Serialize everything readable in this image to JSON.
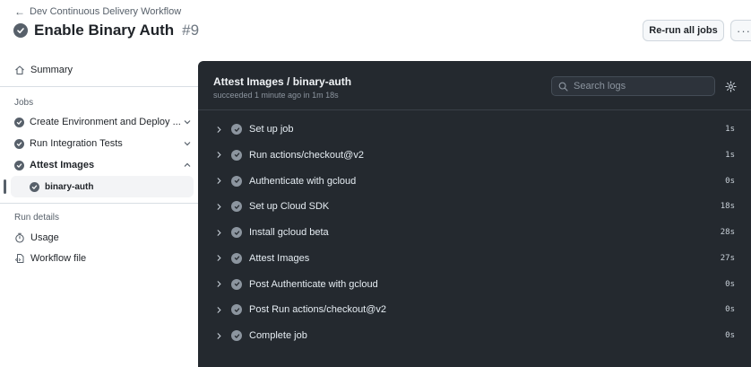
{
  "header": {
    "back_link": "Dev Continuous Delivery Workflow",
    "title": "Enable Binary Auth",
    "run_number": "#9",
    "rerun_label": "Re-run all jobs",
    "more_label": "···"
  },
  "sidebar": {
    "summary_label": "Summary",
    "jobs_heading": "Jobs",
    "jobs": [
      {
        "label": "Create Environment and Deploy ..."
      },
      {
        "label": "Run Integration Tests"
      },
      {
        "label": "Attest Images"
      }
    ],
    "sub_job": "binary-auth",
    "details_heading": "Run details",
    "details": [
      {
        "label": "Usage"
      },
      {
        "label": "Workflow file"
      }
    ]
  },
  "panel": {
    "title": "Attest Images / binary-auth",
    "subtitle": "succeeded 1 minute ago in 1m 18s",
    "search_placeholder": "Search logs",
    "steps": [
      {
        "name": "Set up job",
        "time": "1s"
      },
      {
        "name": "Run actions/checkout@v2",
        "time": "1s"
      },
      {
        "name": "Authenticate with gcloud",
        "time": "0s"
      },
      {
        "name": "Set up Cloud SDK",
        "time": "18s"
      },
      {
        "name": "Install gcloud beta",
        "time": "28s"
      },
      {
        "name": "Attest Images",
        "time": "27s"
      },
      {
        "name": "Post Authenticate with gcloud",
        "time": "0s"
      },
      {
        "name": "Post Run actions/checkout@v2",
        "time": "0s"
      },
      {
        "name": "Complete job",
        "time": "0s"
      }
    ]
  },
  "colors": {
    "panel_bg": "#24292f",
    "success_gray": "#57606a",
    "text_dark": "#1f2328"
  }
}
